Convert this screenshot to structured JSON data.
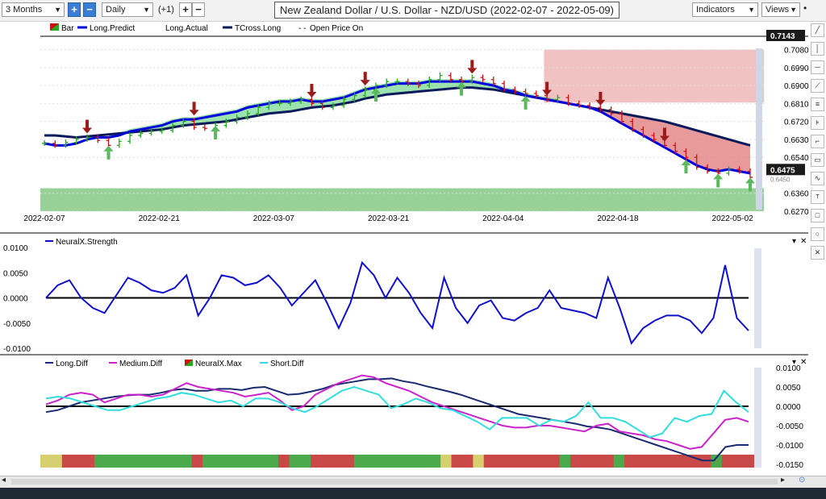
{
  "toolbar": {
    "period_value": "3 Months",
    "interval_value": "Daily",
    "offset_label": "(+1)",
    "plus": "+",
    "minus": "−",
    "indicators_label": "Indicators",
    "views_label": "Views"
  },
  "chart_title": "New Zealand Dollar / U.S. Dollar - NZD/USD (2022-02-07 - 2022-05-09)",
  "legend_top": [
    "Bar",
    "Long.Predict",
    "Long.Actual",
    "TCross.Long",
    "Open Price On"
  ],
  "legend_mid": [
    "NeuralX.Strength"
  ],
  "legend_bottom": [
    "Long.Diff",
    "Medium.Diff",
    "NeuralX.Max",
    "Short.Diff"
  ],
  "colors": {
    "up_bar": "#22aa22",
    "down_bar": "#cc1111",
    "long_predict": "#0000dd",
    "tcross_long": "#0a1a5a",
    "band_fill": "#4ccc70",
    "bear_fill": "#e07878",
    "support_zone": "#8ccc8c",
    "strength_line": "#1010cc",
    "long_diff": "#1a2a70",
    "medium_diff": "#cc22cc",
    "short_diff": "#33dddd"
  },
  "chart_data": [
    {
      "type": "candlestick",
      "x_labels": [
        "2022-02-07",
        "2022-02-21",
        "2022-03-07",
        "2022-03-21",
        "2022-04-04",
        "2022-04-18",
        "2022-05-02"
      ],
      "ylim": [
        0.627,
        0.7143
      ],
      "y_ticks": [
        0.708,
        0.699,
        0.69,
        0.681,
        0.672,
        0.663,
        0.654,
        0.636,
        0.627
      ],
      "y_tick_labels": [
        "0.7080",
        "0.6990",
        "0.6900",
        "0.6810",
        "0.6720",
        "0.6630",
        "0.6540",
        "0.6360",
        "0.6270"
      ],
      "top_label": "0.7143",
      "last_price_label": "0.6475",
      "hidden_label": "0.6450",
      "close": [
        0.661,
        0.66,
        0.6615,
        0.663,
        0.664,
        0.6625,
        0.66,
        0.662,
        0.665,
        0.666,
        0.667,
        0.6675,
        0.67,
        0.672,
        0.669,
        0.6685,
        0.67,
        0.672,
        0.674,
        0.676,
        0.679,
        0.681,
        0.681,
        0.682,
        0.683,
        0.681,
        0.679,
        0.68,
        0.683,
        0.685,
        0.688,
        0.69,
        0.692,
        0.692,
        0.691,
        0.69,
        0.693,
        0.695,
        0.693,
        0.692,
        0.694,
        0.693,
        0.691,
        0.688,
        0.687,
        0.686,
        0.685,
        0.683,
        0.684,
        0.681,
        0.68,
        0.679,
        0.678,
        0.676,
        0.672,
        0.668,
        0.665,
        0.663,
        0.66,
        0.657,
        0.654,
        0.649,
        0.647,
        0.646,
        0.648,
        0.647,
        0.644
      ],
      "predict": [
        0.661,
        0.66,
        0.66,
        0.661,
        0.663,
        0.664,
        0.664,
        0.665,
        0.667,
        0.668,
        0.669,
        0.67,
        0.672,
        0.673,
        0.673,
        0.674,
        0.675,
        0.676,
        0.677,
        0.679,
        0.68,
        0.681,
        0.682,
        0.682,
        0.683,
        0.682,
        0.682,
        0.683,
        0.684,
        0.686,
        0.688,
        0.689,
        0.69,
        0.691,
        0.691,
        0.691,
        0.692,
        0.692,
        0.692,
        0.692,
        0.692,
        0.691,
        0.69,
        0.688,
        0.687,
        0.685,
        0.684,
        0.683,
        0.682,
        0.681,
        0.68,
        0.679,
        0.677,
        0.674,
        0.671,
        0.668,
        0.665,
        0.662,
        0.659,
        0.656,
        0.653,
        0.65,
        0.648,
        0.647,
        0.648,
        0.647,
        0.646
      ],
      "tcross": [
        0.665,
        0.665,
        0.6645,
        0.664,
        0.6645,
        0.665,
        0.6655,
        0.666,
        0.6665,
        0.667,
        0.6675,
        0.668,
        0.669,
        0.67,
        0.6705,
        0.671,
        0.6715,
        0.672,
        0.673,
        0.674,
        0.675,
        0.676,
        0.6765,
        0.677,
        0.678,
        0.679,
        0.6795,
        0.68,
        0.681,
        0.682,
        0.6835,
        0.6845,
        0.6855,
        0.686,
        0.6865,
        0.687,
        0.6875,
        0.688,
        0.6885,
        0.689,
        0.689,
        0.6885,
        0.688,
        0.687,
        0.686,
        0.685,
        0.684,
        0.683,
        0.682,
        0.681,
        0.68,
        0.679,
        0.678,
        0.677,
        0.676,
        0.675,
        0.674,
        0.673,
        0.672,
        0.6705,
        0.669,
        0.6675,
        0.666,
        0.6645,
        0.663,
        0.6615,
        0.66
      ],
      "buy_signals": [
        6,
        16,
        31,
        39,
        45,
        60,
        63,
        66
      ],
      "sell_signals": [
        4,
        14,
        25,
        30,
        40,
        47,
        52,
        58
      ],
      "support_zone": [
        0.627,
        0.6385
      ],
      "resistance_zone": [
        0.6815,
        0.708
      ],
      "resistance_start_index": 52
    },
    {
      "type": "line",
      "legend": "NeuralX.Strength",
      "ylim": [
        -0.01,
        0.01
      ],
      "y_ticks": [
        0.01,
        0.005,
        0.0,
        -0.005,
        -0.01
      ],
      "y_tick_labels": [
        "0.0100",
        "0.0050",
        "0.0000",
        "-0.0050",
        "-0.0100"
      ],
      "values": [
        0.0,
        0.0025,
        0.0035,
        0.0,
        -0.002,
        -0.003,
        0.0005,
        0.004,
        0.003,
        0.0015,
        0.001,
        0.002,
        0.0045,
        -0.0035,
        0.0,
        0.0045,
        0.004,
        0.0025,
        0.003,
        0.0045,
        0.002,
        -0.0015,
        0.001,
        0.0035,
        -0.001,
        -0.006,
        -0.001,
        0.007,
        0.0045,
        0.0,
        0.004,
        0.001,
        -0.003,
        -0.006,
        0.004,
        -0.002,
        -0.005,
        -0.0015,
        -0.0005,
        -0.004,
        -0.0045,
        -0.003,
        -0.002,
        0.0015,
        -0.002,
        -0.0025,
        -0.003,
        -0.004,
        0.004,
        -0.002,
        -0.009,
        -0.006,
        -0.0045,
        -0.0035,
        -0.0035,
        -0.0045,
        -0.007,
        -0.004,
        0.0065,
        -0.004,
        -0.0065
      ]
    },
    {
      "type": "line",
      "ylim": [
        -0.015,
        0.01
      ],
      "y_ticks": [
        0.01,
        0.005,
        0.0,
        -0.005,
        -0.01,
        -0.015
      ],
      "y_tick_labels": [
        "0.0100",
        "0.0050",
        "0.0000",
        "-0.0050",
        "-0.0100",
        "-0.0150"
      ],
      "series": [
        {
          "name": "Long.Diff",
          "values": [
            -0.0015,
            -0.001,
            0.0,
            0.001,
            0.0015,
            0.002,
            0.0025,
            0.0028,
            0.003,
            0.003,
            0.0035,
            0.0042,
            0.0045,
            0.004,
            0.004,
            0.0045,
            0.0045,
            0.0042,
            0.0048,
            0.005,
            0.004,
            0.003,
            0.0032,
            0.0038,
            0.0045,
            0.0055,
            0.006,
            0.0065,
            0.007,
            0.007,
            0.0072,
            0.0065,
            0.006,
            0.0052,
            0.0045,
            0.0038,
            0.003,
            0.002,
            0.001,
            0.0,
            -0.001,
            -0.002,
            -0.0025,
            -0.003,
            -0.0035,
            -0.004,
            -0.0045,
            -0.0052,
            -0.0055,
            -0.006,
            -0.007,
            -0.008,
            -0.009,
            -0.01,
            -0.011,
            -0.012,
            -0.013,
            -0.014,
            -0.014,
            -0.0105,
            -0.01,
            -0.01
          ]
        },
        {
          "name": "Medium.Diff",
          "values": [
            0.0005,
            0.0015,
            0.003,
            0.0035,
            0.003,
            0.001,
            0.002,
            0.003,
            0.003,
            0.0025,
            0.003,
            0.0045,
            0.006,
            0.005,
            0.0045,
            0.004,
            0.0035,
            0.0025,
            0.003,
            0.0035,
            0.0015,
            -0.001,
            0.0,
            0.003,
            0.0045,
            0.006,
            0.007,
            0.008,
            0.0075,
            0.006,
            0.005,
            0.004,
            0.0025,
            0.001,
            0.0,
            -0.001,
            -0.002,
            -0.003,
            -0.004,
            -0.005,
            -0.0055,
            -0.0055,
            -0.005,
            -0.005,
            -0.0055,
            -0.006,
            -0.0065,
            -0.005,
            -0.0045,
            -0.0065,
            -0.007,
            -0.0075,
            -0.0085,
            -0.009,
            -0.01,
            -0.011,
            -0.0105,
            -0.007,
            -0.0035,
            -0.003,
            -0.004
          ]
        },
        {
          "name": "Short.Diff",
          "values": [
            0.002,
            0.0025,
            0.002,
            0.001,
            0.0,
            -0.001,
            -0.001,
            0.0,
            0.001,
            0.002,
            0.0025,
            0.0035,
            0.003,
            0.002,
            0.001,
            0.0015,
            0.0,
            0.002,
            0.002,
            0.001,
            -0.0005,
            -0.0015,
            0.0,
            0.002,
            0.004,
            0.005,
            0.004,
            0.003,
            -0.0005,
            0.0005,
            0.002,
            0.001,
            -0.0005,
            -0.001,
            -0.0025,
            -0.004,
            -0.006,
            -0.003,
            -0.003,
            -0.003,
            -0.005,
            -0.0035,
            -0.004,
            -0.0025,
            0.001,
            -0.003,
            -0.003,
            -0.004,
            -0.006,
            -0.008,
            -0.007,
            -0.003,
            -0.004,
            -0.0025,
            -0.002,
            0.004,
            0.001,
            -0.0015
          ]
        }
      ],
      "neuralx_max": [
        "y",
        "y",
        "r",
        "r",
        "r",
        "g",
        "g",
        "g",
        "g",
        "g",
        "g",
        "g",
        "g",
        "g",
        "r",
        "g",
        "g",
        "g",
        "g",
        "g",
        "g",
        "g",
        "r",
        "g",
        "g",
        "r",
        "r",
        "r",
        "r",
        "g",
        "g",
        "g",
        "g",
        "g",
        "g",
        "g",
        "g",
        "y",
        "r",
        "r",
        "y",
        "r",
        "r",
        "r",
        "r",
        "r",
        "r",
        "r",
        "g",
        "r",
        "r",
        "r",
        "r",
        "g",
        "r",
        "r",
        "r",
        "r",
        "r",
        "r",
        "r",
        "r",
        "g",
        "r",
        "r",
        "r"
      ]
    }
  ]
}
